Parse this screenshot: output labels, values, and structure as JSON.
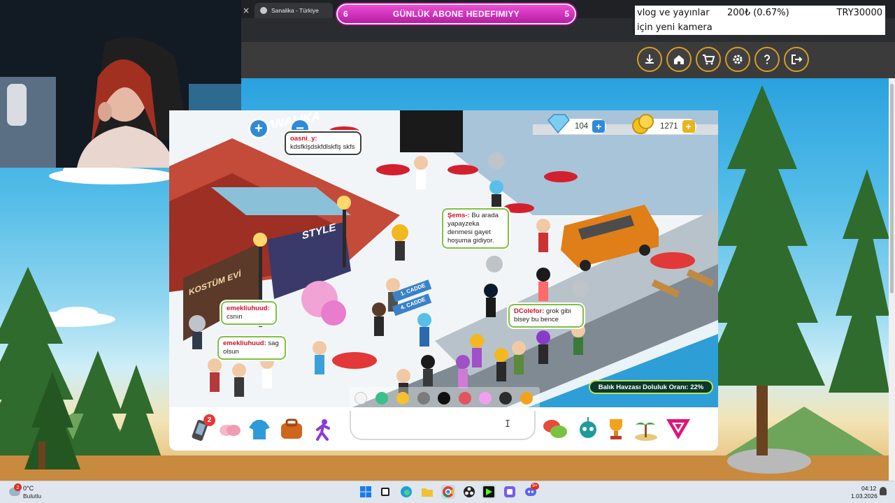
{
  "browser": {
    "tab_title": "Sanalika - Türkiye",
    "close_symbol": "×"
  },
  "subscriber_goal": {
    "current": "6",
    "label": "GÜNLÜK ABONE HEDEFIMIYY",
    "target": "5",
    "color": "#d93bc3"
  },
  "donation_goal": {
    "line1": "vlog ve yayınlar",
    "line2": "için yeni kamera",
    "amount": "200₺ (0.67%)",
    "target": "TRY30000"
  },
  "game_header": {
    "buttons": [
      "download-icon",
      "home-icon",
      "cart-icon",
      "settings-icon",
      "help-icon",
      "logout-icon"
    ]
  },
  "game": {
    "gem_count": "104",
    "coin_count": "1271",
    "zoom_in": "+",
    "zoom_out": "−",
    "signs": {
      "store": "SANALIKA",
      "style": "STYLE",
      "costume": "KOSTÜM EVİ",
      "street1": "1. CADDE",
      "street4": "4. CADDE"
    },
    "chat_bubbles": [
      {
        "user": "oasni_y:",
        "text": "kdsfklşdskfdlskflş skfs"
      },
      {
        "user": "Şems-:",
        "text": "Bu arada yapayzeka denmesi gayet hoşuma gidiyor."
      },
      {
        "user": "emekliuhuud:",
        "text": "csnın"
      },
      {
        "user": "emekliuhuud:",
        "text": "sag olsun"
      },
      {
        "user": "DColefor:",
        "text": "grok gibi bisey bu bence"
      }
    ],
    "fish_label": "Balık Havzası Doluluk Oranı: 22%",
    "palette": [
      "#f4f4f4",
      "#3cc08a",
      "#f6c12e",
      "#7b7b7b",
      "#101010",
      "#e3545f",
      "#f0a0f0",
      "#2c2c2c",
      "#f2a31b"
    ],
    "notification_count": "2",
    "bottom_left_icons": [
      "phone-icon",
      "friends-icon",
      "clothes-icon",
      "bag-icon",
      "dance-icon"
    ],
    "bottom_right_icons": [
      "chat-bubbles-icon",
      "robot-icon",
      "trophy-icon",
      "island-icon",
      "menu-triangle-icon"
    ]
  },
  "taskbar": {
    "weather_temp": "0°C",
    "weather_desc": "Bulutlu",
    "weather_badge": "2",
    "time": "04:12",
    "date": "1.03.2026",
    "discord_badge": "9+",
    "apps": [
      "start-icon",
      "task-view-icon",
      "edge-icon",
      "file-explorer-icon",
      "chrome-icon",
      "obs-icon",
      "streamer-app-icon",
      "app-icon",
      "discord-icon"
    ]
  }
}
